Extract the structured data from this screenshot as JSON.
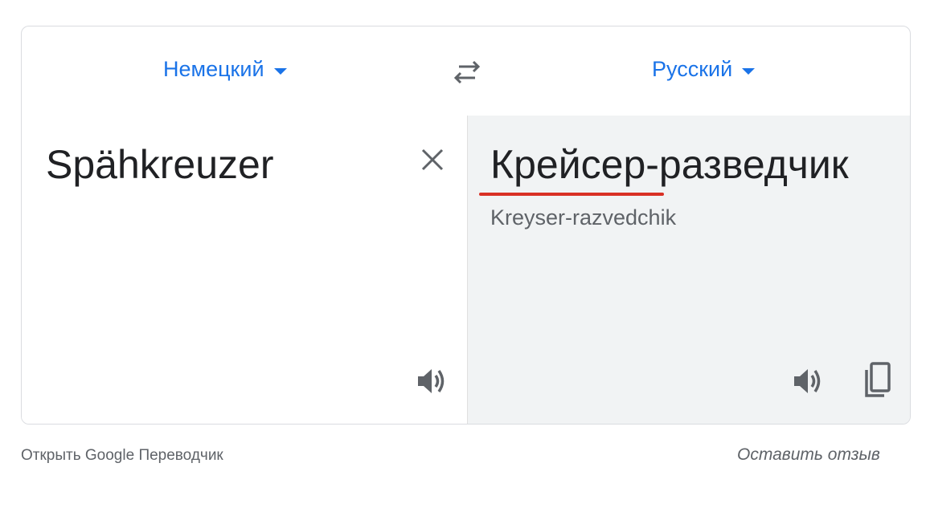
{
  "header": {
    "source_language": "Немецкий",
    "target_language": "Русский"
  },
  "source": {
    "text": "Spähkreuzer"
  },
  "target": {
    "text": "Крейсер-разведчик",
    "transliteration": "Kreyser-razvedchik"
  },
  "footer": {
    "open_translator": "Открыть Google Переводчик",
    "feedback": "Оставить отзыв"
  },
  "colors": {
    "accent": "#1a73e8",
    "underline": "#d93025",
    "target_bg": "#f1f3f4"
  },
  "icons": [
    "caret-down-icon",
    "swap-icon",
    "close-icon",
    "speaker-icon",
    "copy-icon"
  ]
}
